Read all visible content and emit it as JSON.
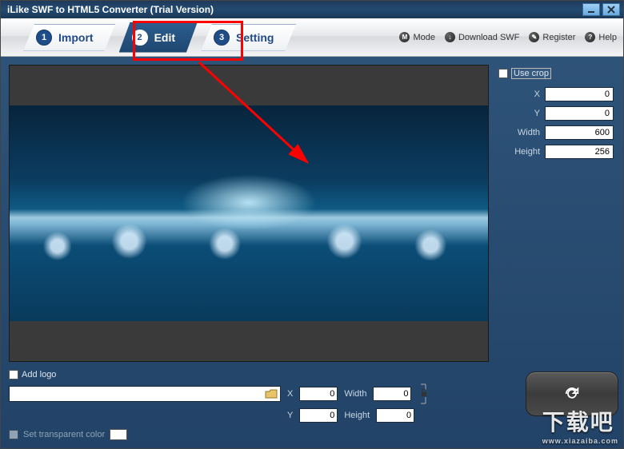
{
  "window": {
    "title": "iLike SWF to HTML5 Converter (Trial Version)"
  },
  "tabs": [
    {
      "num": "1",
      "label": "Import"
    },
    {
      "num": "2",
      "label": "Edit"
    },
    {
      "num": "3",
      "label": "Setting"
    }
  ],
  "toolbar_links": {
    "mode": {
      "icon": "M",
      "label": "Mode"
    },
    "download": {
      "icon": "↓",
      "label": "Download SWF"
    },
    "register": {
      "icon": "✎",
      "label": "Register"
    },
    "help": {
      "icon": "?",
      "label": "Help"
    }
  },
  "crop": {
    "use_crop_label": "Use crop",
    "x_label": "X",
    "x_value": "0",
    "y_label": "Y",
    "y_value": "0",
    "w_label": "Width",
    "w_value": "600",
    "h_label": "Height",
    "h_value": "256"
  },
  "logo": {
    "add_logo_label": "Add logo",
    "path_value": "",
    "x_label": "X",
    "x_value": "0",
    "y_label": "Y",
    "y_value": "0",
    "w_label": "Width",
    "w_value": "0",
    "h_label": "Height",
    "h_value": "0",
    "transparent_label": "Set transparent color"
  },
  "watermark": {
    "text": "下载吧",
    "sub": "www.xiazaiba.com"
  }
}
